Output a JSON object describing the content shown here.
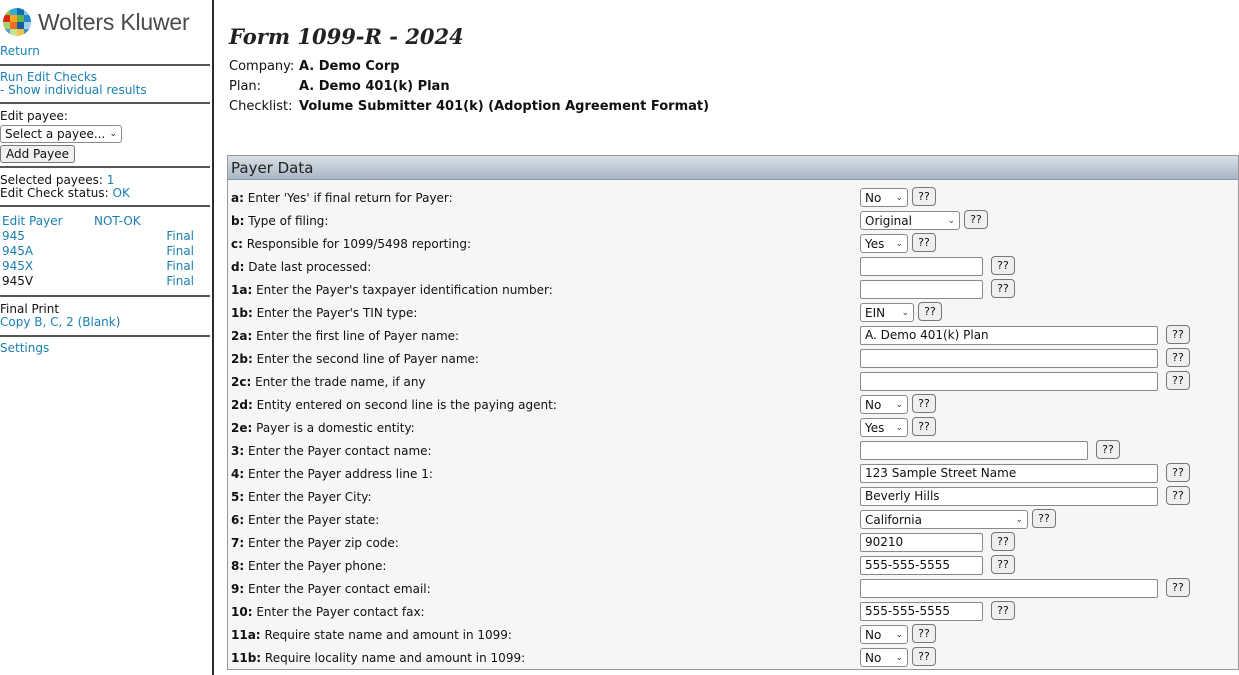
{
  "sidebar": {
    "brand": "Wolters Kluwer",
    "return_link": "Return",
    "run_edit_checks": "Run Edit Checks",
    "show_individual": "- Show individual results",
    "edit_payee_label": "Edit payee:",
    "select_payee": "Select a payee...",
    "add_payee": "Add Payee",
    "selected_payees_label": "Selected payees:",
    "selected_payees_count": "1",
    "edit_check_label": "Edit Check status:",
    "edit_check_status": "OK",
    "edit_payer": "Edit Payer",
    "not_ok": "NOT-OK",
    "forms": [
      {
        "name": "945",
        "status": "Final",
        "link": true
      },
      {
        "name": "945A",
        "status": "Final",
        "link": true
      },
      {
        "name": "945X",
        "status": "Final",
        "link": true
      },
      {
        "name": "945V",
        "status": "Final",
        "link": false
      }
    ],
    "final_print": "Final Print",
    "copy_link": "Copy B, C, 2 (Blank)",
    "settings": "Settings"
  },
  "header": {
    "title": "Form 1099-R - 2024",
    "company_label": "Company:",
    "company": "A. Demo Corp",
    "plan_label": "Plan:",
    "plan": "A. Demo 401(k) Plan",
    "checklist_label": "Checklist:",
    "checklist": "Volume Submitter 401(k) (Adoption Agreement Format)"
  },
  "panel": {
    "title": "Payer Data",
    "help_label": "??",
    "rows": [
      {
        "code": "a:",
        "text": "Enter 'Yes' if final return for Payer:",
        "type": "select",
        "value": "No"
      },
      {
        "code": "b:",
        "text": "Type of filing:",
        "type": "select",
        "value": "Original"
      },
      {
        "code": "c:",
        "text": "Responsible for 1099/5498 reporting:",
        "type": "select",
        "value": "Yes"
      },
      {
        "code": "d:",
        "text": "Date last processed:",
        "type": "text",
        "value": ""
      },
      {
        "code": "1a:",
        "text": "Enter the Payer's taxpayer identification number:",
        "type": "text",
        "value": ""
      },
      {
        "code": "1b:",
        "text": "Enter the Payer's TIN type:",
        "type": "select",
        "value": "EIN"
      },
      {
        "code": "2a:",
        "text": "Enter the first line of Payer name:",
        "type": "text",
        "value": "A. Demo 401(k) Plan"
      },
      {
        "code": "2b:",
        "text": "Enter the second line of Payer name:",
        "type": "text",
        "value": ""
      },
      {
        "code": "2c:",
        "text": "Enter the trade name, if any",
        "type": "text",
        "value": ""
      },
      {
        "code": "2d:",
        "text": "Entity entered on second line is the paying agent:",
        "type": "select",
        "value": "No"
      },
      {
        "code": "2e:",
        "text": "Payer is a domestic entity:",
        "type": "select",
        "value": "Yes"
      },
      {
        "code": "3:",
        "text": "Enter the Payer contact name:",
        "type": "text",
        "value": ""
      },
      {
        "code": "4:",
        "text": "Enter the Payer address line 1:",
        "type": "text",
        "value": "123 Sample Street Name"
      },
      {
        "code": "5:",
        "text": "Enter the Payer City:",
        "type": "text",
        "value": "Beverly Hills"
      },
      {
        "code": "6:",
        "text": "Enter the Payer state:",
        "type": "select",
        "value": "California"
      },
      {
        "code": "7:",
        "text": "Enter the Payer zip code:",
        "type": "text",
        "value": "90210"
      },
      {
        "code": "8:",
        "text": "Enter the Payer phone:",
        "type": "text",
        "value": "555-555-5555"
      },
      {
        "code": "9:",
        "text": "Enter the Payer contact email:",
        "type": "text",
        "value": ""
      },
      {
        "code": "10:",
        "text": "Enter the Payer contact fax:",
        "type": "text",
        "value": "555-555-5555"
      },
      {
        "code": "11a:",
        "text": "Require state name and amount in 1099:",
        "type": "select",
        "value": "No"
      },
      {
        "code": "11b:",
        "text": "Require locality name and amount in 1099:",
        "type": "select",
        "value": "No"
      }
    ]
  },
  "colors": {
    "link": "#1a7fb0",
    "header_top": "#d8dfe6",
    "header_bottom": "#a9b6c4"
  }
}
